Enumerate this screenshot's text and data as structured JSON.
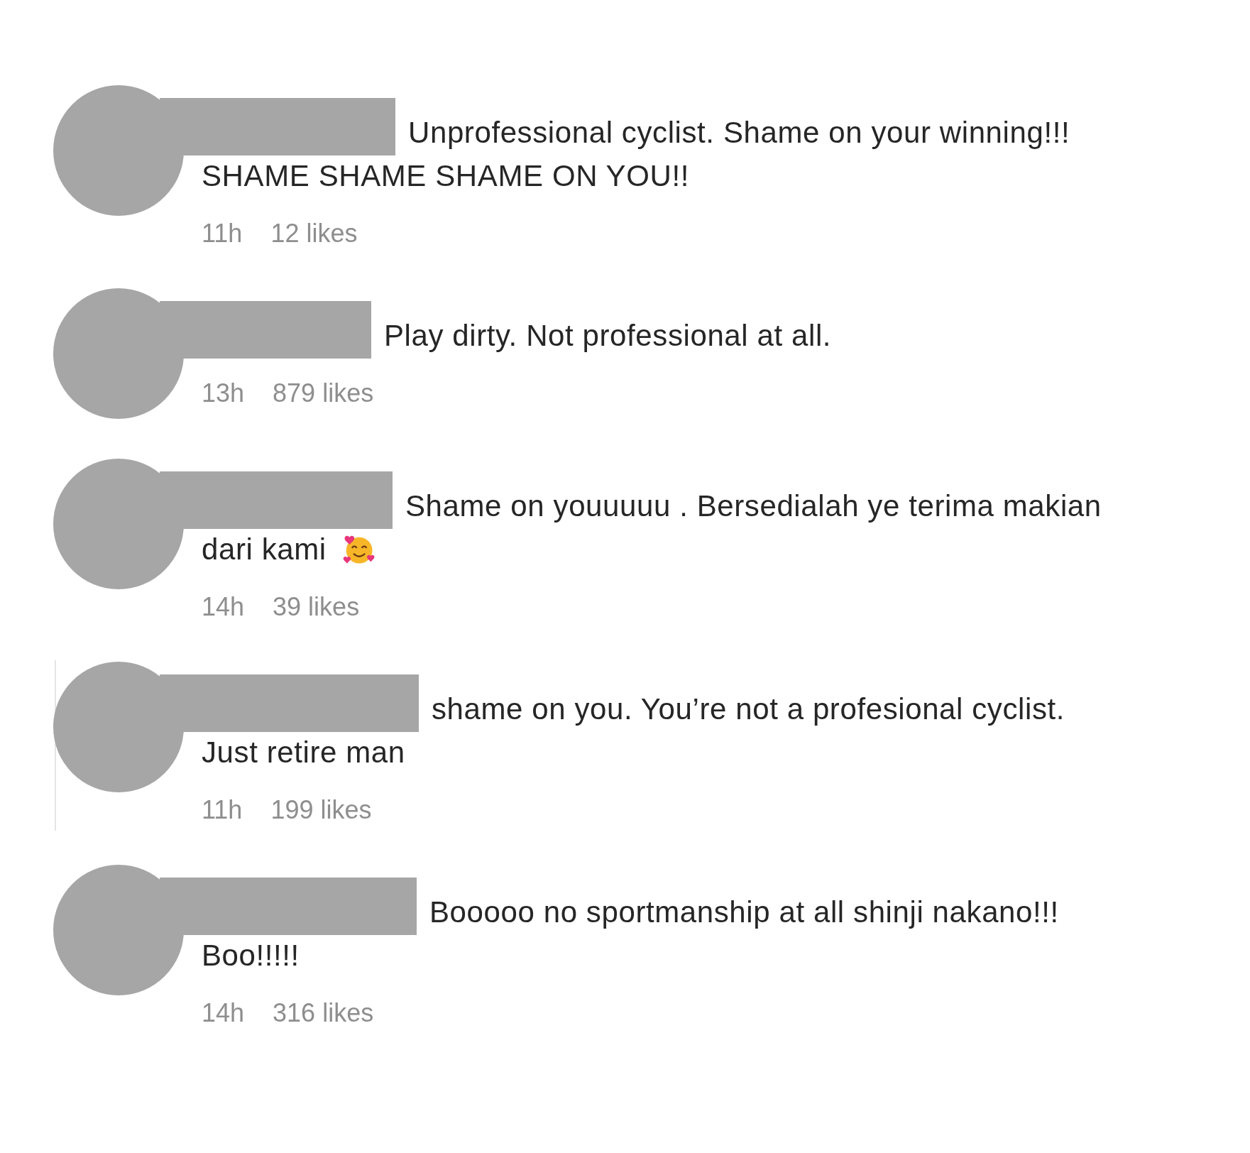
{
  "comments": [
    {
      "lines": [
        "Unprofessional cyclist. Shame on your winning!!!",
        "SHAME SHAME SHAME ON YOU!!"
      ],
      "emoji_after": false,
      "time": "11h",
      "likes": "12 likes",
      "in_thread": false
    },
    {
      "lines": [
        "Play dirty. Not professional at all."
      ],
      "emoji_after": false,
      "time": "13h",
      "likes": "879 likes",
      "in_thread": false
    },
    {
      "lines": [
        "Shame on youuuuu . Bersedialah ye terima makian",
        "dari kami"
      ],
      "emoji_after": true,
      "time": "14h",
      "likes": "39 likes",
      "in_thread": false
    },
    {
      "lines": [
        "shame on you. You’re not a profesional cyclist.",
        "Just retire man"
      ],
      "emoji_after": false,
      "time": "11h",
      "likes": "199 likes",
      "in_thread": true
    },
    {
      "lines": [
        "Booooo no sportmanship at all shinji nakano!!!",
        "Boo!!!!!"
      ],
      "emoji_after": false,
      "time": "14h",
      "likes": "316 likes",
      "in_thread": false
    }
  ]
}
